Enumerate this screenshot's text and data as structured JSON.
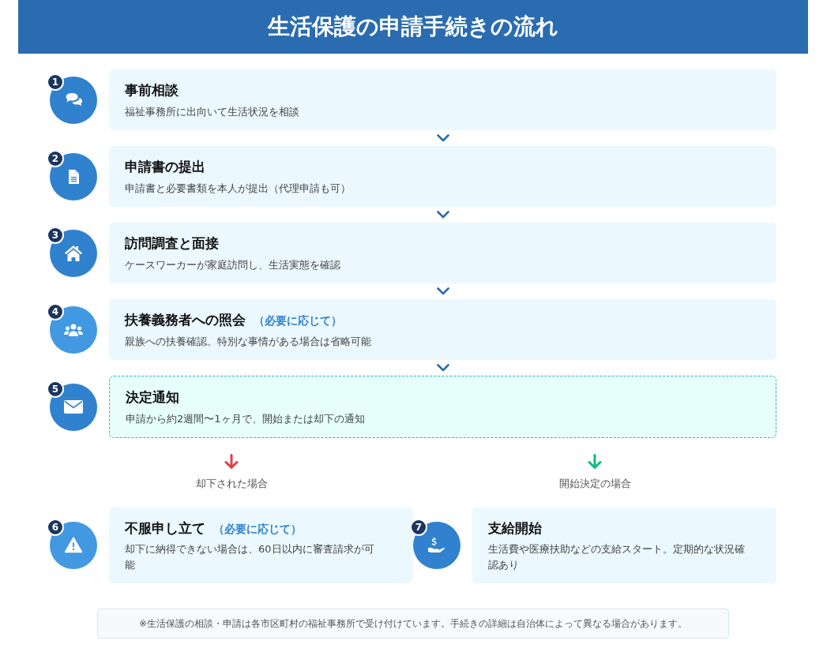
{
  "title": "生活保護の申請手続きの流れ",
  "steps": [
    {
      "number": "1",
      "color": "#3182ce",
      "kind": "normal",
      "title": "事前相談",
      "description": "福祉事務所に出向いて生活状況を相談"
    },
    {
      "number": "2",
      "color": "#3182ce",
      "kind": "normal",
      "title": "申請書の提出",
      "description": "申請書と必要書類を本人が提出（代理申請も可）"
    },
    {
      "number": "3",
      "color": "#3182ce",
      "kind": "normal",
      "title": "訪問調査と面接",
      "description": "ケースワーカーが家庭訪問し、生活実態を確認"
    },
    {
      "number": "4",
      "color": "#4299e1",
      "kind": "normal",
      "title": "扶養義務者への照会",
      "note": "（必要に応じて）",
      "description": "親族への扶養確認。特別な事情がある場合は省略可能"
    },
    {
      "number": "5",
      "color": "#3182ce",
      "kind": "decision",
      "title": "決定通知",
      "description": "申請から約2週間〜1ヶ月で、開始または却下の通知"
    }
  ],
  "branches": [
    {
      "color": "#e53e3e",
      "label": "却下された場合",
      "step": {
        "number": "6",
        "color": "#4299e1",
        "title": "不服申し立て",
        "note": "（必要に応じて）",
        "description": "却下に納得できない場合は、60日以内に審査請求が可能"
      }
    },
    {
      "color": "#10b981",
      "label": "開始決定の場合",
      "step": {
        "number": "7",
        "color": "#3182ce",
        "title": "支給開始",
        "description": "生活費や医療扶助などの支給スタート。定期的な状況確認あり"
      }
    }
  ],
  "footnote": "※生活保護の相談・申請は各市区町村の福祉事務所で受け付けています。手続きの詳細は自治体によって異なる場合があります。"
}
